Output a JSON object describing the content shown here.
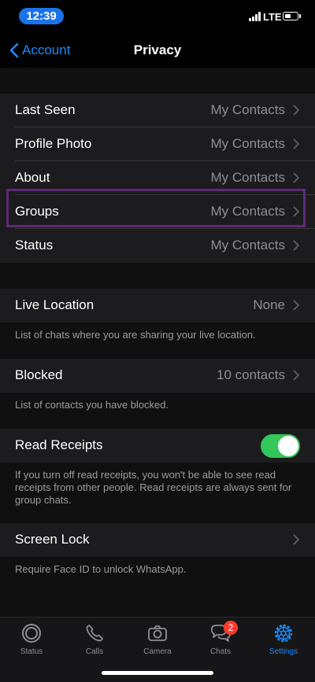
{
  "status_bar": {
    "time": "12:39",
    "network": "LTE"
  },
  "nav": {
    "back_label": "Account",
    "title": "Privacy"
  },
  "section1": [
    {
      "label": "Last Seen",
      "value": "My Contacts"
    },
    {
      "label": "Profile Photo",
      "value": "My Contacts"
    },
    {
      "label": "About",
      "value": "My Contacts"
    },
    {
      "label": "Groups",
      "value": "My Contacts"
    },
    {
      "label": "Status",
      "value": "My Contacts"
    }
  ],
  "live_location": {
    "label": "Live Location",
    "value": "None",
    "footer": "List of chats where you are sharing your live location."
  },
  "blocked": {
    "label": "Blocked",
    "value": "10 contacts",
    "footer": "List of contacts you have blocked."
  },
  "read_receipts": {
    "label": "Read Receipts",
    "enabled": true,
    "footer": "If you turn off read receipts, you won't be able to see read receipts from other people. Read receipts are always sent for group chats."
  },
  "screen_lock": {
    "label": "Screen Lock",
    "footer": "Require Face ID to unlock WhatsApp."
  },
  "tabs": [
    {
      "label": "Status",
      "icon": "status-icon"
    },
    {
      "label": "Calls",
      "icon": "phone-icon"
    },
    {
      "label": "Camera",
      "icon": "camera-icon"
    },
    {
      "label": "Chats",
      "icon": "chat-bubbles-icon",
      "badge": "2"
    },
    {
      "label": "Settings",
      "icon": "gear-icon",
      "active": true
    }
  ],
  "colors": {
    "accent": "#1a8cff",
    "toggle_on": "#34c759",
    "highlight_box": "#5e2a78",
    "badge": "#ff3b30"
  }
}
